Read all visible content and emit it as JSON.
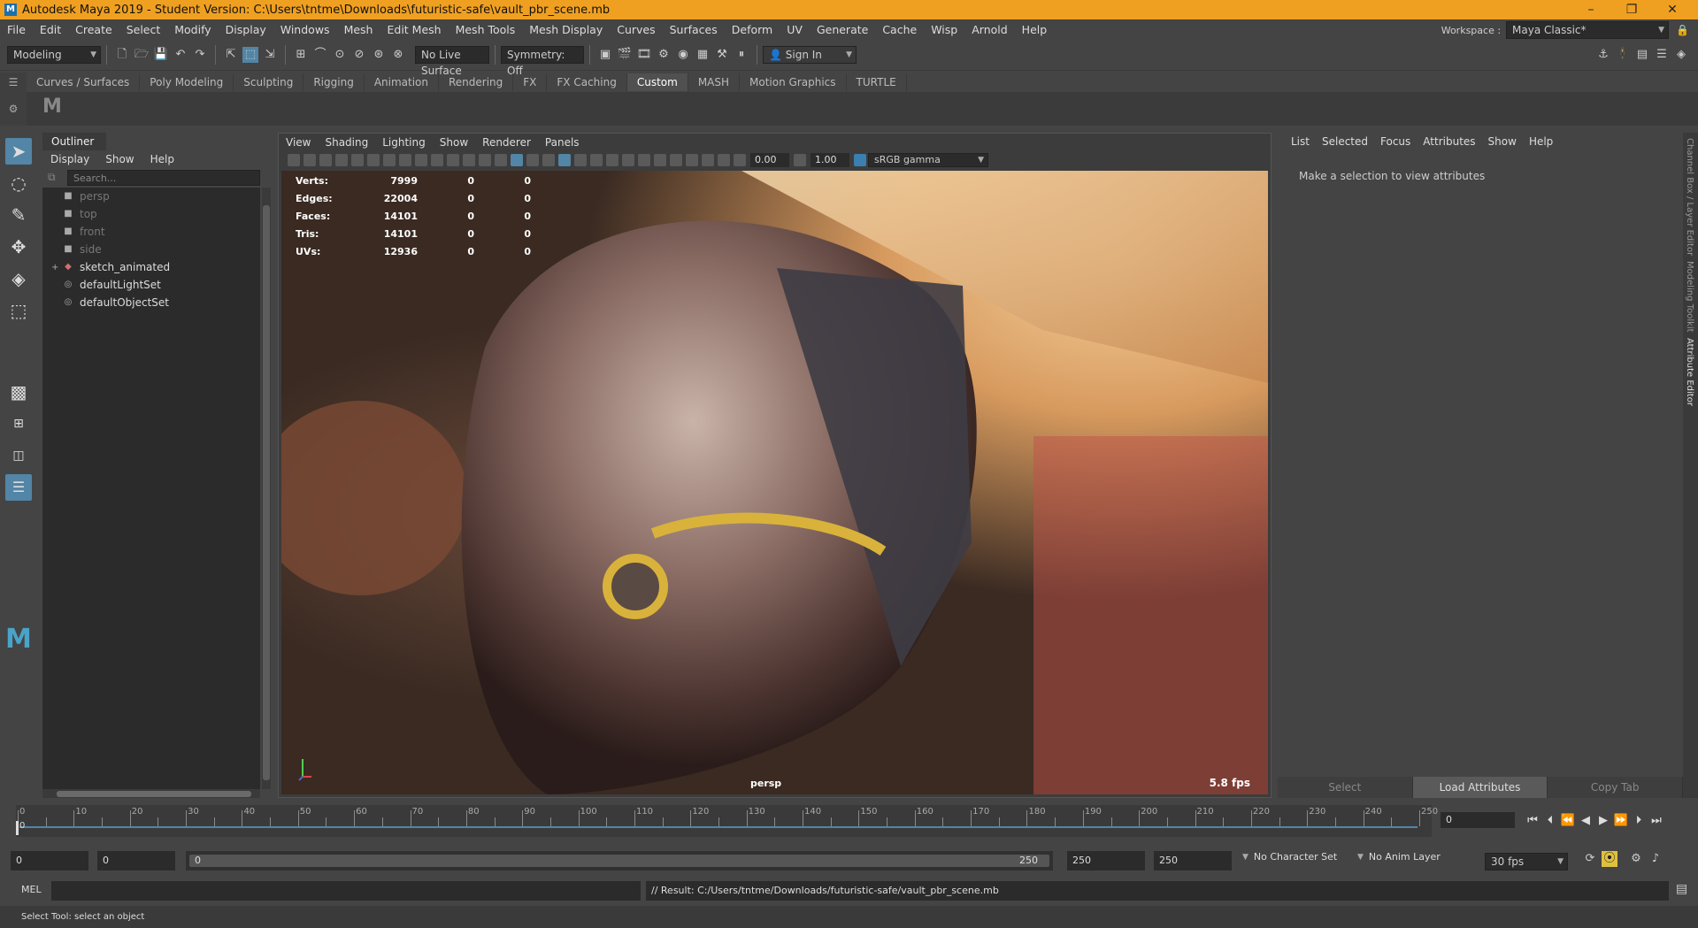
{
  "window": {
    "title": "Autodesk Maya 2019 - Student Version: C:\\Users\\tntme\\Downloads\\futuristic-safe\\vault_pbr_scene.mb",
    "logo": "M",
    "buttons": [
      "–",
      "❐",
      "✕"
    ]
  },
  "menubar": {
    "items": [
      "File",
      "Edit",
      "Create",
      "Select",
      "Modify",
      "Display",
      "Windows",
      "Mesh",
      "Edit Mesh",
      "Mesh Tools",
      "Mesh Display",
      "Curves",
      "Surfaces",
      "Deform",
      "UV",
      "Generate",
      "Cache",
      "Wisp",
      "Arnold",
      "Help"
    ],
    "workspace_label": "Workspace :",
    "workspace_value": "Maya Classic*"
  },
  "statusline": {
    "menuset": "Modeling",
    "live_surface": "No Live Surface",
    "symmetry": "Symmetry: Off",
    "sign_in": "Sign In"
  },
  "shelf": {
    "tabs": [
      "Curves / Surfaces",
      "Poly Modeling",
      "Sculpting",
      "Rigging",
      "Animation",
      "Rendering",
      "FX",
      "FX Caching",
      "Custom",
      "MASH",
      "Motion Graphics",
      "TURTLE"
    ],
    "active_tab": "Custom"
  },
  "outliner": {
    "title": "Outliner",
    "menu": [
      "Display",
      "Show",
      "Help"
    ],
    "search_placeholder": "Search...",
    "items": [
      {
        "label": "persp",
        "icon": "camera-icon",
        "dim": true
      },
      {
        "label": "top",
        "icon": "camera-icon",
        "dim": true
      },
      {
        "label": "front",
        "icon": "camera-icon",
        "dim": true
      },
      {
        "label": "side",
        "icon": "camera-icon",
        "dim": true
      },
      {
        "label": "sketch_animated",
        "icon": "mesh-icon",
        "dim": false,
        "expand": "+"
      },
      {
        "label": "defaultLightSet",
        "icon": "set-icon",
        "dim": false
      },
      {
        "label": "defaultObjectSet",
        "icon": "set-icon",
        "dim": false
      }
    ]
  },
  "viewport": {
    "menu": [
      "View",
      "Shading",
      "Lighting",
      "Show",
      "Renderer",
      "Panels"
    ],
    "exposure": "0.00",
    "gamma": "1.00",
    "color_space": "sRGB gamma",
    "hud": [
      {
        "label": "Verts:",
        "v1": "7999",
        "v2": "0",
        "v3": "0"
      },
      {
        "label": "Edges:",
        "v1": "22004",
        "v2": "0",
        "v3": "0"
      },
      {
        "label": "Faces:",
        "v1": "14101",
        "v2": "0",
        "v3": "0"
      },
      {
        "label": "Tris:",
        "v1": "14101",
        "v2": "0",
        "v3": "0"
      },
      {
        "label": "UVs:",
        "v1": "12936",
        "v2": "0",
        "v3": "0"
      }
    ],
    "camera": "persp",
    "fps": "5.8 fps"
  },
  "attribute_editor": {
    "menu": [
      "List",
      "Selected",
      "Focus",
      "Attributes",
      "Show",
      "Help"
    ],
    "message": "Make a selection to view attributes",
    "buttons": [
      "Select",
      "Load Attributes",
      "Copy Tab"
    ],
    "side_tabs": [
      "Channel Box / Layer Editor",
      "Modeling Toolkit",
      "Attribute Editor"
    ]
  },
  "timeline": {
    "labels": [
      "0",
      "10",
      "20",
      "30",
      "40",
      "50",
      "60",
      "70",
      "80",
      "90",
      "100",
      "110",
      "120",
      "130",
      "140",
      "150",
      "160",
      "170",
      "180",
      "190",
      "200",
      "210",
      "220",
      "230",
      "240",
      "250"
    ],
    "current_frame": "0"
  },
  "range": {
    "start": "0",
    "playback_start": "0",
    "slider_start": "0",
    "slider_end": "250",
    "playback_end": "250",
    "end": "250",
    "character_set": "No Character Set",
    "anim_layer": "No Anim Layer",
    "fps": "30 fps"
  },
  "commandline": {
    "lang": "MEL",
    "result": "// Result: C:/Users/tntme/Downloads/futuristic-safe/vault_pbr_scene.mb"
  },
  "helpline": {
    "text": "Select Tool: select an object"
  }
}
